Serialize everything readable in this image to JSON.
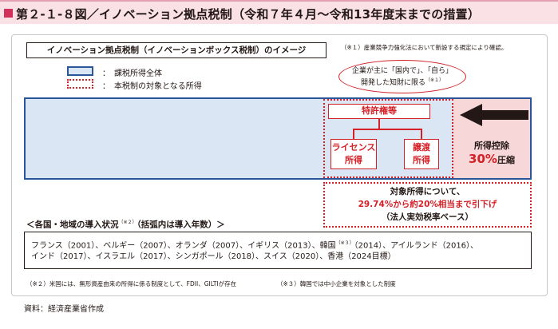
{
  "header": {
    "title": "第２-１-８図／イノベーション拠点税制（令和７年４月〜令和13年度末までの措置）"
  },
  "diagram": {
    "image_title": "イノベーション拠点税制（イノベーションボックス税制）のイメージ",
    "note1": "（※１）産業競争力強化法において新設する規定により確認。",
    "legend": {
      "blue_label": "：　課税所得全体",
      "red_label": "：　本税制の対象となる所得"
    },
    "bubble": {
      "line1": "企業が主に「国内で」、「自ら」",
      "line2": "開発した知財に限る",
      "note_ref": "（※１）"
    },
    "patent_label": "特許権等",
    "license_line1": "ライセンス",
    "license_line2": "所得",
    "transfer_line1": "譲渡",
    "transfer_line2": "所得",
    "deduction_label": "所得控除",
    "deduction_rate": "30%",
    "deduction_suffix": "圧縮",
    "result_line1": "対象所得について、",
    "result_line2": "29.74%から約20%相当まで引下げ",
    "result_line3": "（法人実効税率ベース）",
    "colors": {
      "accent_red": "#d42027",
      "bar_blue": "#2b5599",
      "bar_fill": "#dbe6f5",
      "deduction_fill": "#f7d7d7",
      "title_pink": "#d0305a"
    }
  },
  "countries": {
    "heading_main": "＜各国・地域の導入状況",
    "heading_note": "（※２）",
    "heading_rest": "（括弧内は導入年数）＞",
    "line1_a": "フランス（2001）、ベルギー（2007）、オランダ（2007）、イギリス（2013）、韓国",
    "line1_note": "（※３）",
    "line1_b": "（2014）、アイルランド（2016）、",
    "line2": "インド（2017）、イスラエル（2017）、シンガポール（2018）、スイス（2020）、香港（2024目標）"
  },
  "footnotes": {
    "note2": "（※２）米国には、無形資産由来の所得に係る制度として、FDII、GILTIが存在",
    "note3": "（※３）韓国では中小企業を対象とした制度"
  },
  "source": "資料：経済産業省作成"
}
